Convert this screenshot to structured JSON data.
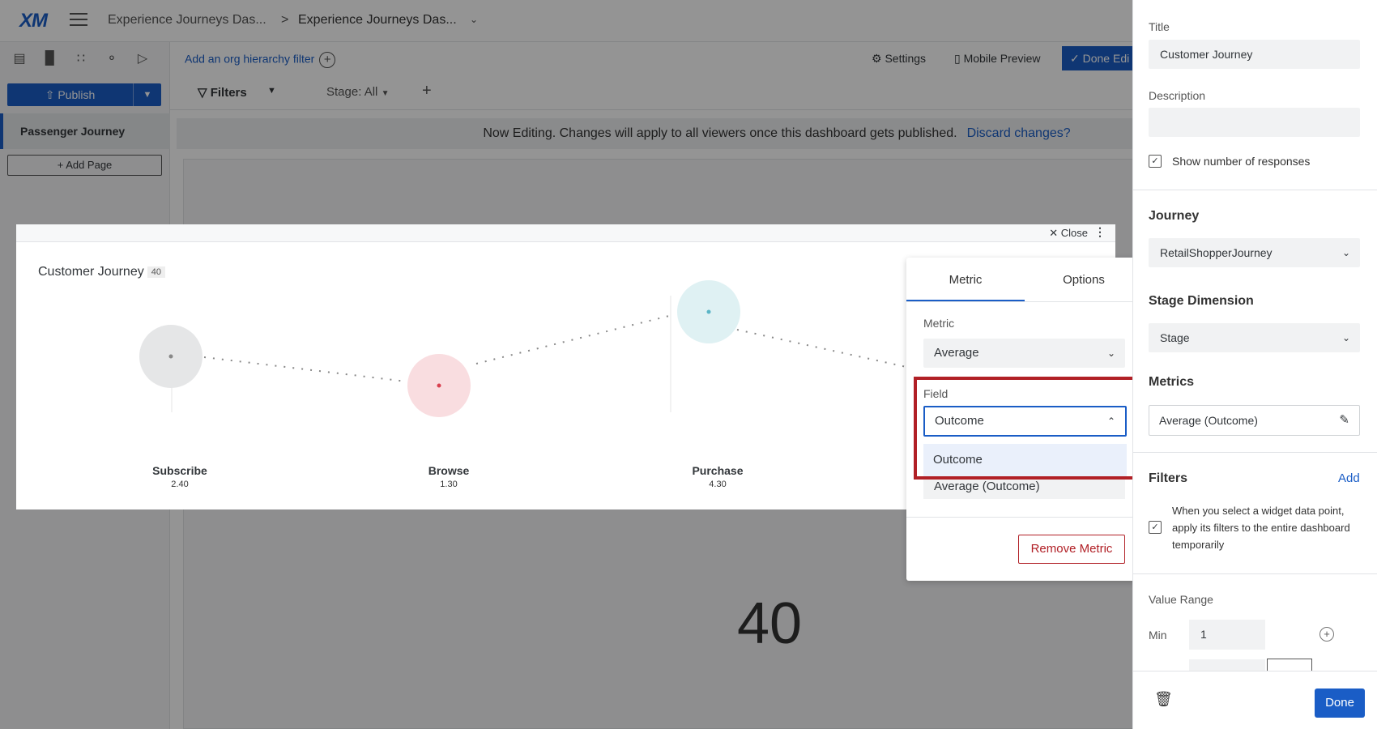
{
  "app": {
    "logo": "XM",
    "breadcrumb_1": "Experience Journeys Das...",
    "breadcrumb_sep": ">",
    "breadcrumb_2": "Experience Journeys Das..."
  },
  "sidebar": {
    "publish_label": "Publish",
    "page_label": "Passenger Journey",
    "add_page_label": "Add Page"
  },
  "toolbar": {
    "org_filter_label": "Add an org hierarchy filter",
    "settings_label": "Settings",
    "mobile_label": "Mobile Preview",
    "done_edit_label": "Done Edi"
  },
  "filterbar": {
    "filters_label": "Filters",
    "stage_label": "Stage: All"
  },
  "banner": {
    "text": "Now Editing. Changes will apply to all viewers once this dashboard gets published.",
    "discard": "Discard changes?"
  },
  "canvas": {
    "big_number": "40"
  },
  "widget": {
    "close_label": "Close",
    "title": "Customer Journey",
    "count": "40",
    "stages": [
      {
        "name": "Subscribe",
        "value": "2.40",
        "color": "#e5e6e7",
        "dot": "#888888"
      },
      {
        "name": "Browse",
        "value": "1.30",
        "color": "#f9dde0",
        "dot": "#d9404f"
      },
      {
        "name": "Purchase",
        "value": "4.30",
        "color": "#dff1f3",
        "dot": "#5bb5c6"
      }
    ]
  },
  "popover": {
    "tab_metric": "Metric",
    "tab_options": "Options",
    "metric_label": "Metric",
    "metric_value": "Average",
    "field_label": "Field",
    "field_value": "Outcome",
    "field_option": "Outcome",
    "avg_outcome": "Average (Outcome)",
    "remove_label": "Remove Metric"
  },
  "panel": {
    "title_label": "Title",
    "title_value": "Customer Journey",
    "description_label": "Description",
    "description_value": "",
    "show_responses_label": "Show number of responses",
    "journey_head": "Journey",
    "journey_value": "RetailShopperJourney",
    "stage_dim_head": "Stage Dimension",
    "stage_dim_value": "Stage",
    "metrics_head": "Metrics",
    "metrics_value": "Average (Outcome)",
    "filters_head": "Filters",
    "filters_add": "Add",
    "filters_text": "When you select a widget data point, apply its filters to the entire dashboard temporarily",
    "value_range_label": "Value Range",
    "min_label": "Min",
    "min_value": "1",
    "done_label": "Done"
  },
  "colors": {
    "accent": "#1a5dc6",
    "highlight": "#b12026"
  }
}
